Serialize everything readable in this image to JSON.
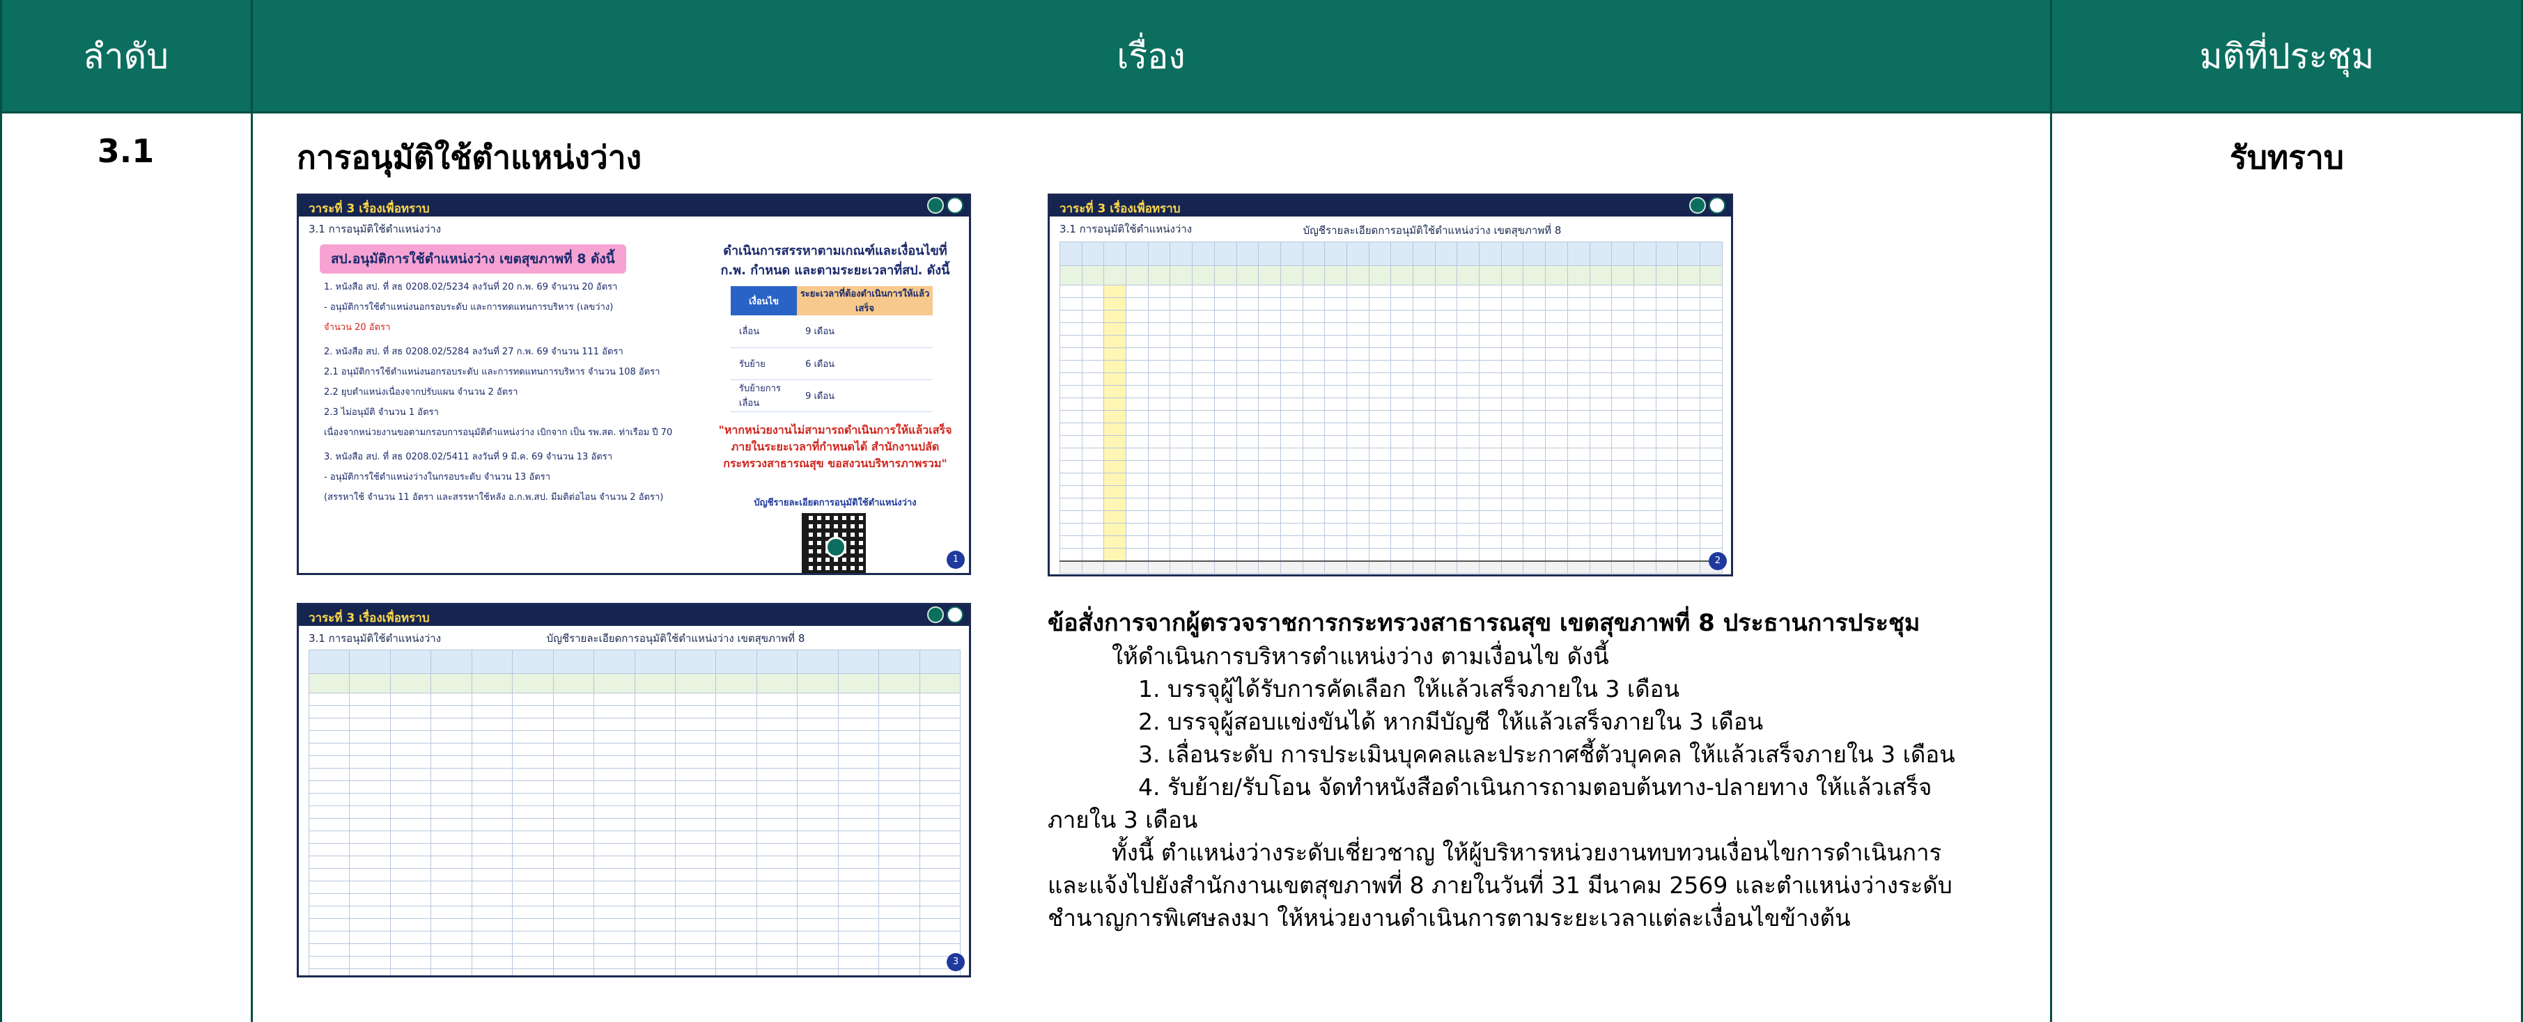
{
  "header": {
    "col_order": "ลำดับ",
    "col_subject": "เรื่อง",
    "col_resolution": "มติที่ประชุม"
  },
  "row": {
    "order": "3.1",
    "title": "การอนุมัติใช้ตำแหน่งว่าง",
    "resolution": "รับทราบ"
  },
  "slides": {
    "slide_title": "วาระที่ 3 เรื่องเพื่อทราบ",
    "slide_subtitle": "3.1 การอนุมัติใช้ตำแหน่งว่าง",
    "slide1": {
      "tag": "สป.อนุมัติการใช้ตำแหน่งว่าง เขตสุขภาพที่ 8 ดังนี้",
      "lines": [
        "1. หนังสือ สป. ที่ สธ 0208.02/5234 ลงวันที่ 20 ก.พ. 69 จำนวน 20 อัตรา",
        "   - อนุมัติการใช้ตำแหน่งนอกรอบระดับ และการทดแทนการบริหาร (เลขว่าง)",
        "   จำนวน 20 อัตรา",
        "2. หนังสือ สป. ที่ สธ 0208.02/5284 ลงวันที่ 27 ก.พ. 69 จำนวน 111 อัตรา",
        "   2.1 อนุมัติการใช้ตำแหน่งนอกรอบระดับ และการทดแทนการบริหาร จำนวน 108 อัตรา",
        "   2.2 ยุบตำแหน่งเนื่องจากปรับแผน จำนวน 2 อัตรา",
        "   2.3 ไม่อนุมัติ จำนวน 1 อัตรา",
        "   เนื่องจากหน่วยงานขอตามกรอบการอนุมัติตำแหน่งว่าง เบิกจาก เป็น รพ.สต. ท่าเรือม ปี 70",
        "3. หนังสือ สป. ที่ สธ 0208.02/5411 ลงวันที่ 9 มี.ค. 69 จำนวน 13 อัตรา",
        "   - อนุมัติการใช้ตำแหน่งว่างในกรอบระดับ จำนวน 13 อัตรา",
        "   (สรรหาใช้ จำนวน 11 อัตรา และสรรหาใช้หลัง อ.ก.พ.สป. มีมติต่อไอน จำนวน 2 อัตรา)"
      ],
      "side_heading": "ดำเนินการสรรหาตามเกณฑ์และเงื่อนไขที่ ก.พ. กำหนด และตามระยะเวลาที่สป. ดังนี้",
      "mini_table": {
        "headers": [
          "เงื่อนไข",
          "ระยะเวลาที่ต้องดำเนินการให้แล้วเสร็จ"
        ],
        "rows": [
          [
            "เลื่อน",
            "9 เดือน"
          ],
          [
            "รับย้าย",
            "6 เดือน"
          ],
          [
            "รับย้ายการเลื่อน",
            "9 เดือน"
          ]
        ]
      },
      "warning": "\"หากหน่วยงานไม่สามารถดำเนินการให้แล้วเสร็จภายในระยะเวลาที่กำหนดได้ สำนักงานปลัดกระทรวงสาธารณสุข ขอสงวนบริหารภาพรวม\"",
      "link": "บัญชีรายละเอียดการอนุมัติใช้ตำแหน่งว่าง",
      "page": "1"
    },
    "slide2": {
      "caption": "บัญชีรายละเอียดการอนุมัติใช้ตำแหน่งว่าง เขตสุขภาพที่ 8",
      "page": "2"
    },
    "slide3": {
      "caption": "บัญชีรายละเอียดการอนุมัติใช้ตำแหน่งว่าง เขตสุขภาพที่ 8",
      "page": "3"
    }
  },
  "directive": {
    "heading": "ข้อสั่งการจากผู้ตรวจราชการกระทรวงสาธารณสุข เขตสุขภาพที่ 8 ประธานการประชุม",
    "intro": "ให้ดำเนินการบริหารตำแหน่งว่าง ตามเงื่อนไข ดังนี้",
    "items": [
      "1. บรรจุผู้ได้รับการคัดเลือก ให้แล้วเสร็จภายใน 3 เดือน",
      "2. บรรจุผู้สอบแข่งขันได้ หากมีบัญชี ให้แล้วเสร็จภายใน 3 เดือน",
      "3. เลื่อนระดับ การประเมินบุคคลและประกาศชี้ตัวบุคคล ให้แล้วเสร็จภายใน 3 เดือน",
      "4. รับย้าย/รับโอน จัดทำหนังสือดำเนินการถามตอบต้นทาง-ปลายทาง ให้แล้วเสร็จ"
    ],
    "item4_cont": "ภายใน 3 เดือน",
    "para1": "ทั้งนี้ ตำแหน่งว่างระดับเชี่ยวชาญ ให้ผู้บริหารหน่วยงานทบทวนเงื่อนไขการดำเนินการ",
    "para2": "และแจ้งไปยังสำนักงานเขตสุขภาพที่ 8 ภายในวันที่ 31 มีนาคม 2569 และตำแหน่งว่างระดับ",
    "para3": "ชำนาญการพิเศษลงมา ให้หน่วยงานดำเนินการตามระยะเวลาแต่ละเงื่อนไขข้างต้น"
  }
}
